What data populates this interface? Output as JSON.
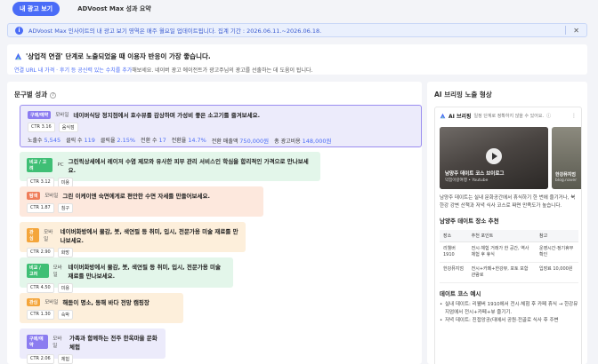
{
  "tabs": [
    {
      "label": "내 광고 보기"
    },
    {
      "label": "ADVoost Max 성과 요약"
    }
  ],
  "banner": {
    "text": "ADVoost Max 인사이트의 내 광고 보기 영역은 매주 월요일 업데이트됩니다. 집계 기간 : 2026.06.11.~2026.06.18.",
    "close_icon": "close-icon"
  },
  "hero": {
    "title": "'상업적 연결' 단계로 노출되었을 때 이용자 반응이 가장 좋습니다.",
    "desc_highlight": "연결 URL 내 가격 · 후기 등 공신력 있는 수치를 추가",
    "desc_rest": "해보세요. 네이버 광고 에이전트가 광고주님의 광고를 선출하는 데 도움이 됩니다."
  },
  "performance": {
    "title": "문구별 성과",
    "help_icon": "question-circle-icon",
    "cards": [
      {
        "tag": "구매/예약",
        "tag_color": "#8b7cf0",
        "bg": "#ecebfb",
        "border": "#9a8cf0",
        "device": "모바일",
        "title": "네이버식당 정지점에서 호수뷰를 감상하며 가성비 좋은 소고기를 즐겨보세요.",
        "chips": [
          "CTR 3.16",
          "음식점"
        ],
        "stats": [
          {
            "label": "노출수",
            "value": "5,545"
          },
          {
            "label": "클릭 수",
            "value": "119"
          },
          {
            "label": "클릭율",
            "value": "2.15%"
          },
          {
            "label": "전환 수",
            "value": "17"
          },
          {
            "label": "전환율",
            "value": "14.7%"
          },
          {
            "label": "전환 매출액",
            "value": "750,000원"
          },
          {
            "label": "총 광고비용",
            "value": "148,000원"
          }
        ]
      },
      {
        "tag": "비교 / 고려",
        "tag_color": "#3fbf75",
        "bg": "#e3f6ea",
        "border": "#e3f6ea",
        "device": "PC",
        "title": "그린릭상세에서 레이저 수염 제모와 유사한 피부 관리 서비스인 학심을 합리적인 가격으로 만나보세요.",
        "chips": [
          "CTR 3.12",
          "미용"
        ]
      },
      {
        "tag": "탐색",
        "tag_color": "#ef7d5a",
        "bg": "#fde8dd",
        "border": "#fde8dd",
        "device": "모바일",
        "title": "그린 이케이엔 숙면에게로 편안한 수면 자세를 만들어보세요.",
        "chips": [
          "CTR 1.87",
          "침구"
        ]
      },
      {
        "tag": "관심",
        "tag_color": "#f4a53a",
        "bg": "#fdefdb",
        "border": "#fdefdb",
        "device": "모바일",
        "title": "네이버화방에서 물감, 붓, 색연필 등 취미, 입시, 전문가용 미술 재료를 만나보세요.",
        "chips": [
          "CTR 2.90",
          "화방"
        ]
      },
      {
        "tag": "비교 / 고려",
        "tag_color": "#3fbf75",
        "bg": "#e3f6ea",
        "border": "#e3f6ea",
        "device": "모바일",
        "title": "네이버화방에서 물감, 붓, 색연필 등 취미, 입시, 전문가용 미술 재료를 만나보세요.",
        "chips": [
          "CTR 4.50",
          "미용"
        ]
      },
      {
        "tag": "관심",
        "tag_color": "#f4a53a",
        "bg": "#fdefdb",
        "border": "#fdefdb",
        "device": "모바일",
        "title": "해돋이 명소, 동해 바다 전망 캠핑장",
        "chips": [
          "CTR 1.30",
          "숙박"
        ]
      },
      {
        "tag": "구매/예약",
        "tag_color": "#8b7cf0",
        "bg": "#ecebfb",
        "border": "#ecebfb",
        "device": "모바일",
        "title": "가족과 함께하는 전주 한옥마을 문화체험",
        "chips": [
          "CTR 2.06",
          "체험"
        ]
      }
    ]
  },
  "briefing": {
    "title": "AI 브리핑 노출 형상",
    "ai_label": "AI 브리핑",
    "ai_sub": "일정 단계로 정확하지 않을 수 있어요.",
    "video1": {
      "title": "남양주 데이트 코스 브이로그",
      "sub": "익힘이랑여행 • Youtube"
    },
    "video2": {
      "title": "한강뮤지엄",
      "sub": "blog.naver"
    },
    "para": "남양주 데이트는 실내 문화공간에서 휴식하기 한 번에 즐기거나, 북한강 강변 산책과 저녁 식사 코스로 짜면 만족도가 높습니다.",
    "places_title": "남양주 데이트 장소 추천",
    "table_head": [
      "장소",
      "추천 포인트",
      "참고"
    ],
    "table_rows": [
      [
        "리웰버 1910",
        "전시·체험 거래가 한 공간, 역사 체험 후 휴식",
        "운영시간·정기휴무 확인"
      ],
      [
        "한강뮤지엄",
        "전시+카페+한강뷰, 포토 포함 관람로",
        "입장료 10,000원"
      ]
    ],
    "course_title": "데이트 코스 예시",
    "course_items": [
      "실내 데이트: 리웰버 1910에서 전시·체험 후 카페 휴식 → 한강뮤지엄에서 전시+카페+뷰 즐기기.",
      "저녁 데이트: 진접앙공(대에서 공원·전골로 식사 후 주변"
    ]
  }
}
